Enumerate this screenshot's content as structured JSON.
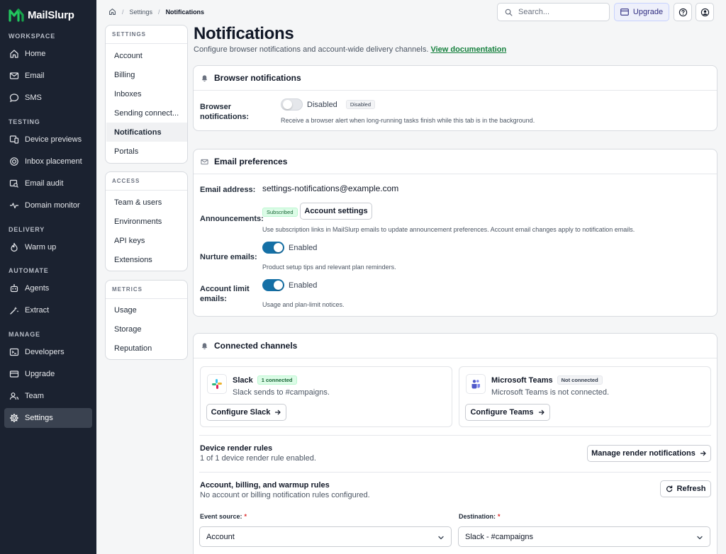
{
  "app": {
    "name": "MailSlurp",
    "brand_color": "#22c55e",
    "accent_color": "#1570a6"
  },
  "sidebar": {
    "sections": [
      {
        "label": "WORKSPACE",
        "items": [
          {
            "label": "Home",
            "icon": "home-icon"
          },
          {
            "label": "Email",
            "icon": "mail-icon"
          },
          {
            "label": "SMS",
            "icon": "chat-icon"
          }
        ]
      },
      {
        "label": "TESTING",
        "items": [
          {
            "label": "Device previews",
            "icon": "device-icon"
          },
          {
            "label": "Inbox placement",
            "icon": "target-icon"
          },
          {
            "label": "Email audit",
            "icon": "audit-icon"
          },
          {
            "label": "Domain monitor",
            "icon": "pulse-icon"
          }
        ]
      },
      {
        "label": "DELIVERY",
        "items": [
          {
            "label": "Warm up",
            "icon": "flame-icon"
          }
        ]
      },
      {
        "label": "AUTOMATE",
        "items": [
          {
            "label": "Agents",
            "icon": "robot-icon"
          },
          {
            "label": "Extract",
            "icon": "extract-icon"
          }
        ]
      },
      {
        "label": "MANAGE",
        "items": [
          {
            "label": "Developers",
            "icon": "terminal-icon"
          },
          {
            "label": "Upgrade",
            "icon": "card-icon"
          },
          {
            "label": "Team",
            "icon": "users-icon"
          },
          {
            "label": "Settings",
            "icon": "gear-icon",
            "active": true
          }
        ]
      }
    ]
  },
  "topbar": {
    "breadcrumb": [
      "Settings",
      "Notifications"
    ],
    "search_placeholder": "Search...",
    "upgrade_label": "Upgrade"
  },
  "settings_nav": {
    "groups": [
      {
        "title": "SETTINGS",
        "items": [
          "Account",
          "Billing",
          "Inboxes",
          "Sending connect...",
          "Notifications",
          "Portals"
        ],
        "active": "Notifications"
      },
      {
        "title": "ACCESS",
        "items": [
          "Team & users",
          "Environments",
          "API keys",
          "Extensions"
        ]
      },
      {
        "title": "METRICS",
        "items": [
          "Usage",
          "Storage",
          "Reputation"
        ]
      }
    ]
  },
  "page": {
    "title": "Notifications",
    "subtitle": "Configure browser notifications and account-wide delivery channels.",
    "doc_link": "View documentation"
  },
  "browser_card": {
    "title": "Browser notifications",
    "label_line1": "Browser",
    "label_line2": "notifications:",
    "toggle_state": false,
    "toggle_text": "Disabled",
    "badge": "Disabled",
    "help": "Receive a browser alert when long-running tasks finish while this tab is in the background."
  },
  "email_card": {
    "title": "Email preferences",
    "address_label": "Email address:",
    "address_value": "settings-notifications@example.com",
    "announcements_label": "Announcements:",
    "announcements_badge": "Subscribed",
    "account_settings_button": "Account settings",
    "announcements_help": "Use subscription links in MailSlurp emails to update announcement preferences. Account email changes apply to notification emails.",
    "nurture_label": "Nurture emails:",
    "nurture_state": true,
    "nurture_text": "Enabled",
    "nurture_help": "Product setup tips and relevant plan reminders.",
    "limit_label_line1": "Account limit",
    "limit_label_line2": "emails:",
    "limit_state": true,
    "limit_text": "Enabled",
    "limit_help": "Usage and plan-limit notices."
  },
  "channels_card": {
    "title": "Connected channels",
    "slack": {
      "name": "Slack",
      "badge": "1 connected",
      "desc": "Slack sends to #campaigns.",
      "button": "Configure Slack"
    },
    "teams": {
      "name": "Microsoft Teams",
      "badge": "Not connected",
      "desc": "Microsoft Teams is not connected.",
      "button": "Configure Teams"
    },
    "render_rules": {
      "title": "Device render rules",
      "desc": "1 of 1 device render rule enabled.",
      "button": "Manage render notifications"
    },
    "account_rules": {
      "title": "Account, billing, and warmup rules",
      "desc": "No account or billing notification rules configured.",
      "button": "Refresh"
    },
    "event_source_label": "Event source:",
    "event_source_value": "Account",
    "destination_label": "Destination:",
    "destination_value": "Slack - #campaigns",
    "required_mark": "*"
  }
}
